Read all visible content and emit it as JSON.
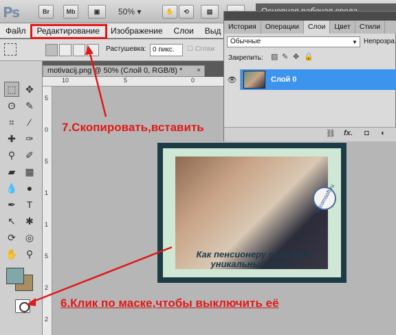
{
  "app": {
    "logo": "Ps",
    "buttons": [
      "Br",
      "Mb"
    ],
    "zoom": "50%",
    "workspace": "Основная рабочая среда"
  },
  "menu": {
    "items": [
      "Файл",
      "Редактирование",
      "Изображение",
      "Слои",
      "Выд"
    ]
  },
  "options": {
    "feather_label": "Растушевка:",
    "feather_value": "0 пикс.",
    "smooth_label": "Сглаж"
  },
  "document": {
    "tab_title": "motivacij.png @ 50% (Слой 0, RGB/8) *",
    "close": "×",
    "ruler_h": [
      "10",
      "5",
      "0",
      "5"
    ],
    "ruler_v": [
      "5",
      "0",
      "5",
      "1",
      "1",
      "5",
      "2",
      "2"
    ]
  },
  "image": {
    "caption": "Как пенсионеру получить уникальный сайт ?",
    "badge": "artcomsoft.ru"
  },
  "layers_panel": {
    "tabs": [
      "История",
      "Операции",
      "Слои",
      "Цвет",
      "Стили"
    ],
    "active_tab": "Слои",
    "blend_mode": "Обычные",
    "opacity_label": "Непрозра",
    "lock_label": "Закрепить:",
    "layer_name": "Слой 0",
    "footer_icons": [
      "link-icon",
      "fx-icon",
      "mask-icon",
      "adjustment-icon"
    ]
  },
  "annotations": {
    "step7": "7.Скопировать,вставить",
    "step6": "6.Клик по маске,чтобы выключить её"
  },
  "colors": {
    "foreground": "#80a8a8",
    "background": "#a88e64",
    "annotation": "#e01818",
    "selected_layer": "#3d94ef"
  }
}
